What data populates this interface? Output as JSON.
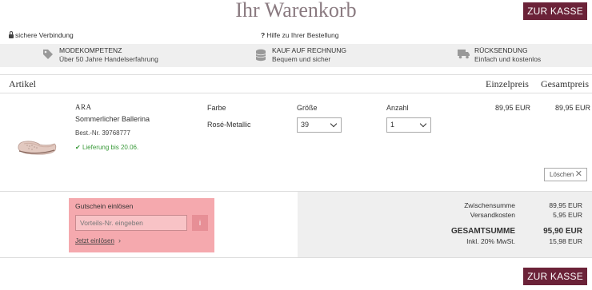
{
  "page": {
    "title": "Ihr Warenkorb",
    "checkout_label": "ZUR KASSE"
  },
  "topbar": {
    "secure_label": "sichere Verbindung",
    "help_label": "Hilfe zu Ihrer Bestellung"
  },
  "features": [
    {
      "title": "MODEKOMPETENZ",
      "subtitle": "Über 50 Jahre Handelserfahrung",
      "icon": "tag-icon"
    },
    {
      "title": "KAUF AUF RECHNUNG",
      "subtitle": "Bequem und sicher",
      "icon": "coins-icon"
    },
    {
      "title": "RÜCKSENDUNG",
      "subtitle": "Einfach und kostenlos",
      "icon": "truck-icon"
    }
  ],
  "table_header": {
    "artikel": "Artikel",
    "einzelpreis": "Einzelpreis",
    "gesamtpreis": "Gesamtpreis"
  },
  "item": {
    "brand": "ARA",
    "name": "Sommerlicher Ballerina",
    "best_nr": "Best.-Nr. 39768777",
    "delivery": "Lieferung bis 20.06.",
    "farbe_label": "Farbe",
    "farbe_value": "Rosé-Metallic",
    "groesse_label": "Größe",
    "groesse_value": "39",
    "anzahl_label": "Anzahl",
    "anzahl_value": "1",
    "einzelpreis": "89,95 EUR",
    "gesamtpreis": "89,95 EUR",
    "delete_label": "Löschen"
  },
  "voucher": {
    "title": "Gutschein einlösen",
    "placeholder": "Vorteils-Nr. eingeben",
    "info_label": "i",
    "link_label": "Jetzt einlösen"
  },
  "summary": {
    "zwischensumme_label": "Zwischensumme",
    "zwischensumme_value": "89,95 EUR",
    "versand_label": "Versandkosten",
    "versand_value": "5,95 EUR",
    "gesamt_label": "GESAMTSUMME",
    "gesamt_value": "95,90 EUR",
    "mwst_label": "Inkl. 20% MwSt.",
    "mwst_value": "15,98 EUR"
  },
  "colors": {
    "accent": "#6b2238",
    "voucher_bg": "#f5a9ae",
    "delivery": "#3a9a3a"
  }
}
